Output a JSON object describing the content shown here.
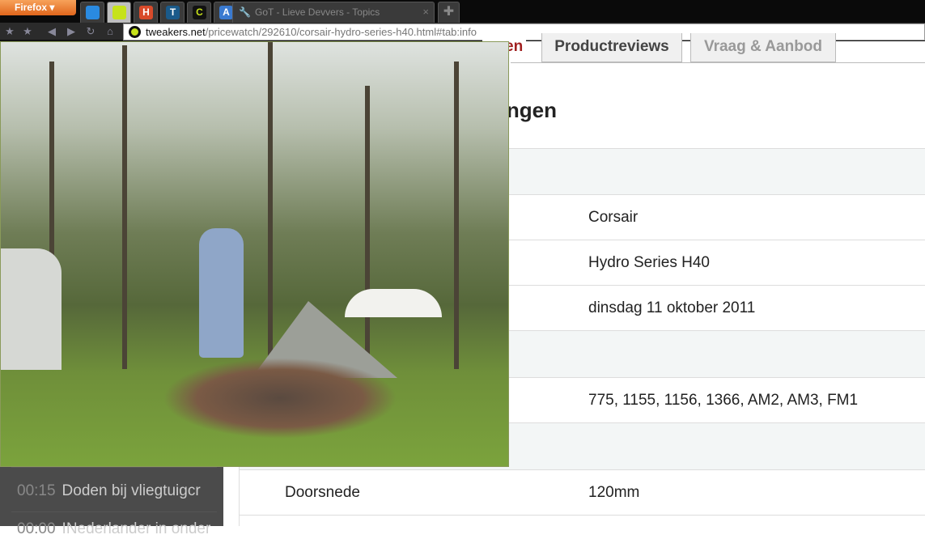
{
  "browser": {
    "menu_label": "Firefox",
    "active_tab_title": "GoT - Lieve Devvers - Topics",
    "url_domain": "tweakers.net",
    "url_path": "/pricewatch/292610/corsair-hydro-series-h40.html#tab:info",
    "pinned_tabs": [
      {
        "icon": "twitter-bird-icon",
        "letter": "",
        "color": "#2a8ae0"
      },
      {
        "icon": "tweakers-icon",
        "letter": "",
        "color": "#c6e21a"
      },
      {
        "icon": "h-icon",
        "letter": "H",
        "color": "#d84a2a"
      },
      {
        "icon": "t-icon",
        "letter": "T",
        "color": "#1a5a8a"
      },
      {
        "icon": "c-icon",
        "letter": "C",
        "color": "#111"
      },
      {
        "icon": "translate-icon",
        "letter": "A",
        "color": "#3a7ad0"
      }
    ]
  },
  "page": {
    "tabs": [
      "en",
      "Productreviews",
      "Vraag & Aanbod"
    ],
    "heading": "ngen",
    "rows": [
      {
        "section": true
      },
      {
        "k": "",
        "v": "Corsair"
      },
      {
        "k": "",
        "v": "Hydro Series H40"
      },
      {
        "k": "",
        "v": "dinsdag 11 oktober 2011"
      },
      {
        "section": true
      },
      {
        "k": "",
        "v": "775, 1155, 1156, 1366, AM2, AM3, FM1"
      },
      {
        "section": true
      },
      {
        "k": "Doorsnede",
        "v": "120mm"
      }
    ]
  },
  "sidebar": {
    "news": [
      {
        "time": "00:15",
        "title": "Doden bij vliegtuigcr"
      },
      {
        "time": "00:00",
        "title": "INederlander in onder"
      }
    ]
  }
}
